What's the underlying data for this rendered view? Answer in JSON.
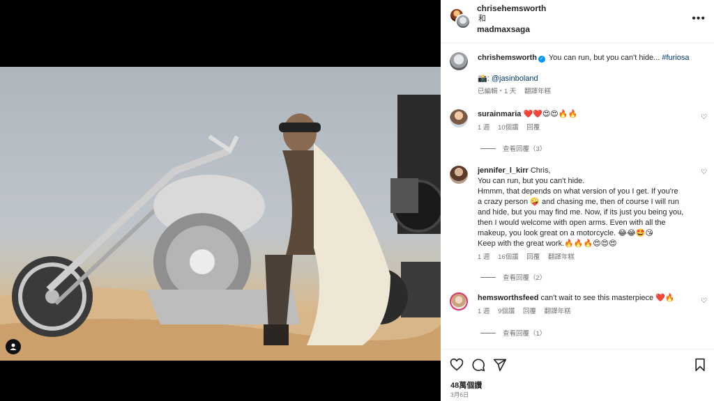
{
  "header": {
    "user1": "chrisehemsworth",
    "and": "和",
    "user2": "madmaxsaga",
    "more_icon": "more-horizontal-icon"
  },
  "caption": {
    "user": "chrishemsworth",
    "text": "You can run, but you can't hide...",
    "hashtag": "#furiosa",
    "camera": "📸:",
    "mention": "@jasinboland",
    "edited": "已編輯・1 天",
    "translate": "翻譯年糕"
  },
  "comments": [
    {
      "user": "surainmaria",
      "text": "❤️❤️😍😍🔥🔥",
      "time": "1 週",
      "likes": "10個讚",
      "reply": "回覆",
      "view_replies": "查看回覆（3）"
    },
    {
      "user": "jennifer_l_kirr",
      "lines": [
        "Chris,",
        "You can run, but you can't hide.",
        "Hmmm, that depends on what version of you I get. If you're",
        "a crazy person 🤪 and chasing me, then of course I will run",
        "and hide, but you may find me. Now, if its just you being you,",
        "then I would welcome with open arms. Even with all the",
        "makeup, you look great on a motorcycle. 😂😂🤩😘",
        "Keep with the great work.🔥🔥🔥😍😍😍"
      ],
      "time": "1 週",
      "likes": "16個讚",
      "reply": "回覆",
      "translate": "翻譯年糕",
      "view_replies": "查看回覆（2）"
    },
    {
      "user": "hemsworthsfeed",
      "text": "can't wait to see this masterpiece ❤️🔥",
      "time": "1 週",
      "likes": "9個讚",
      "reply": "回覆",
      "translate": "翻譯年糕",
      "view_replies": "查看回覆（1）"
    }
  ],
  "actions": {
    "likes": "48萬個讚",
    "date": "3月6日",
    "icons": [
      "heart-icon",
      "comment-icon",
      "share-icon",
      "bookmark-icon"
    ]
  },
  "colors": {
    "link": "#00376b",
    "verified": "#0095f6",
    "muted": "#737373"
  }
}
